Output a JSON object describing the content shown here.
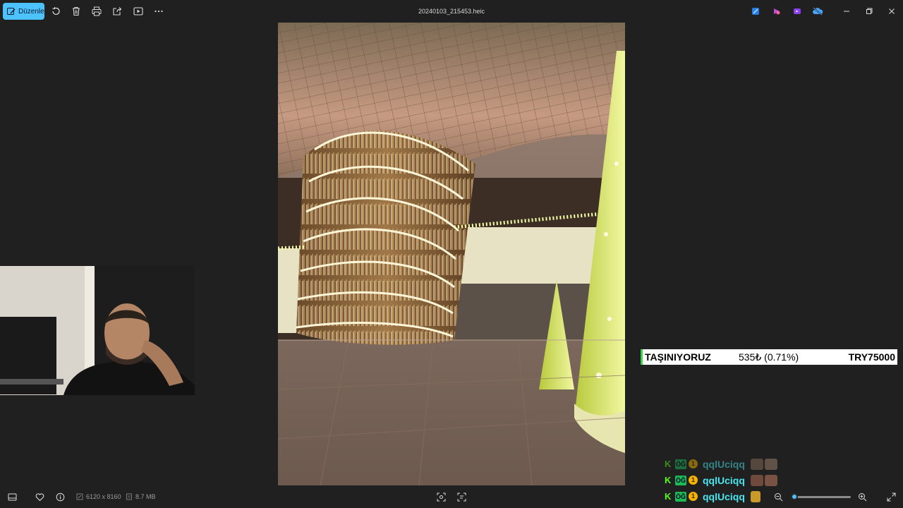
{
  "toolbar": {
    "edit_label": "Düzenle",
    "file_title": "20240103_215453.heic"
  },
  "icons": {
    "edit": "pencil-image-icon",
    "rotate": "rotate-icon",
    "delete": "trash-icon",
    "print": "printer-icon",
    "share": "share-icon",
    "slideshow": "play-icon",
    "more": "ellipsis-icon"
  },
  "ticker": {
    "label": "TAŞINIYORUZ",
    "change": "535₺ (0.71%)",
    "goal": "TRY75000"
  },
  "chat": {
    "messages": [
      {
        "username": "qqlUciqq",
        "badge_og": "ÖĞ",
        "badge_coin": "1"
      },
      {
        "username": "qqlUciqq",
        "badge_og": "ÖĞ",
        "badge_coin": "1"
      },
      {
        "username": "qqlUciqq",
        "badge_og": "ÖĞ",
        "badge_coin": "1"
      }
    ]
  },
  "status": {
    "dimensions": "6120 x 8160",
    "file_size": "8.7 MB"
  },
  "zoom": {
    "level": 0.0
  },
  "colors": {
    "accent": "#4cc2ff",
    "background": "#202020",
    "chat_name": "#48e5ee",
    "kick_green": "#53fc18"
  }
}
